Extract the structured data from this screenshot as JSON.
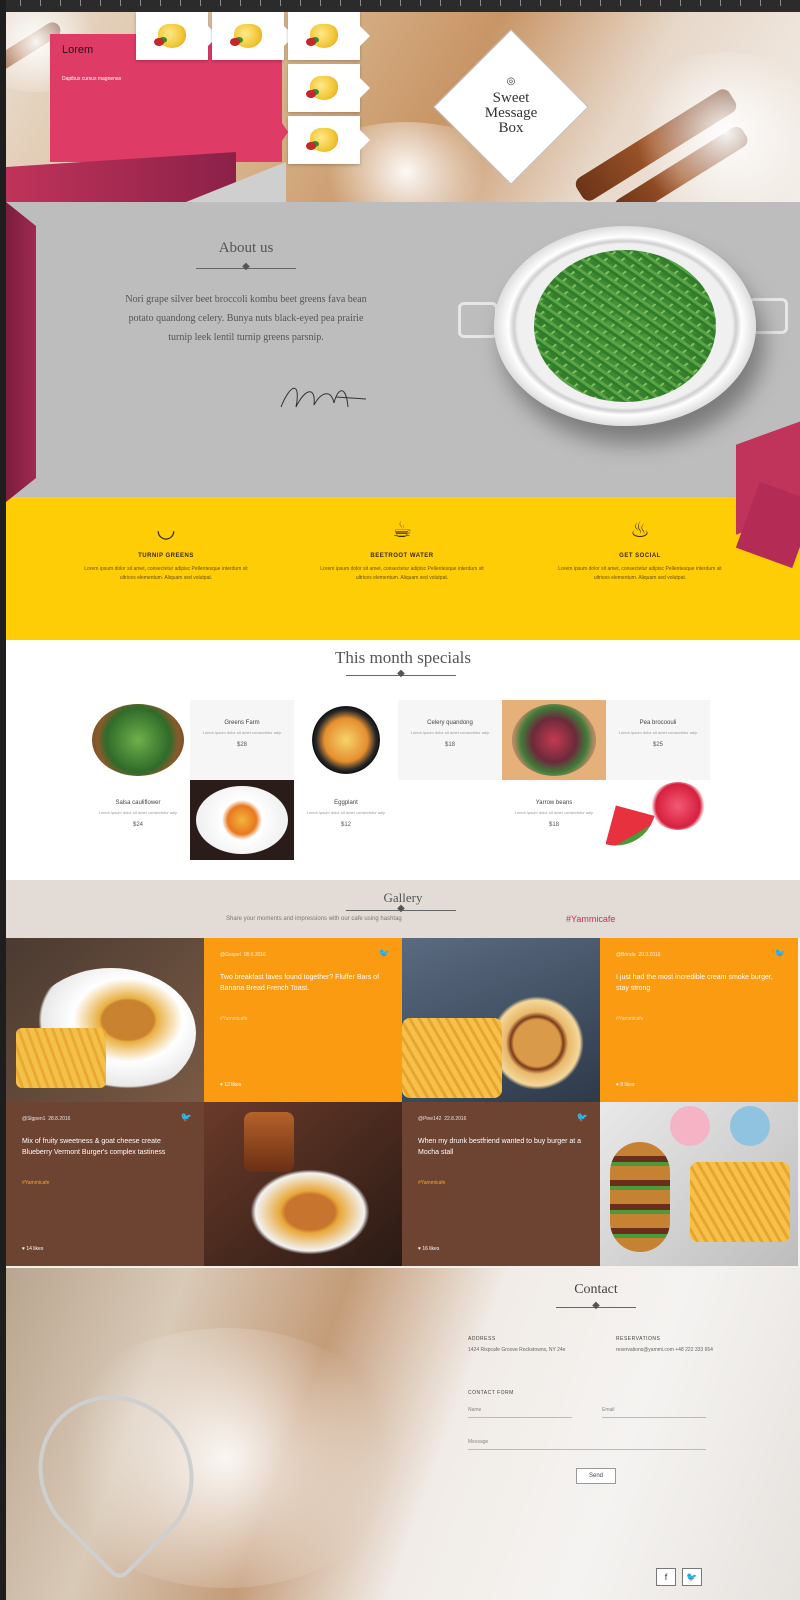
{
  "promo": {
    "title": "Lorem",
    "text": "Dapibus cursus magnenas"
  },
  "logo": {
    "line1": "Sweet",
    "line2": "Message",
    "line3": "Box"
  },
  "about": {
    "title": "About us",
    "text": "Nori grape silver beet broccoli kombu beet greens fava bean potato quandong celery. Bunya nuts black-eyed pea prairie turnip leek lentil turnip greens parsnip."
  },
  "features": [
    {
      "title": "Turnip greens",
      "text": "Lorem ipsum dolor sit amet, consectetur adipisc Pellentesque interdum sit ultrices elementum. Aliquam sed volutpat.",
      "icon": "noodle-bowl-icon"
    },
    {
      "title": "Beetroot water",
      "text": "Lorem ipsum dolor sit amet, consectetur adipisc Pellentesque interdum sit ultrices elementum. Aliquam sed volutpat.",
      "icon": "teapot-icon"
    },
    {
      "title": "Get social",
      "text": "Lorem ipsum dolor sit amet, consectetur adipisc Pellentesque interdum sit ultrices elementum. Aliquam sed volutpat.",
      "icon": "cupcake-icon"
    }
  ],
  "specials": {
    "title": "This month specials",
    "items": [
      {
        "name": "Greens Farm",
        "desc": "Lorem ipsum dolor sit amet consectetur adip",
        "price": "$28"
      },
      {
        "name": "Celery quandong",
        "desc": "Lorem ipsum dolor sit amet consectetur adip",
        "price": "$18"
      },
      {
        "name": "Pea brocoouli",
        "desc": "Lorem ipsum dolor sit amet consectetur adip",
        "price": "$25"
      },
      {
        "name": "Salsa cauliflower",
        "desc": "Lorem ipsum dolor sit amet consectetur adip",
        "price": "$24"
      },
      {
        "name": "Eggplant",
        "desc": "Lorem ipsum dolor sit amet consectetur adip",
        "price": "$12"
      },
      {
        "name": "Yarrow beans",
        "desc": "Lorem ipsum dolor sit amet consectetur adip",
        "price": "$18"
      }
    ]
  },
  "gallery": {
    "title": "Gallery",
    "subtitle": "Share your moments and impressions with our cafe using hashtag",
    "hashtag": "#Yammicafe",
    "posts": [
      {
        "user": "@Gospel",
        "date": "08.6.2016",
        "text": "Two breakfast faves found together? Fluffer Bars of Banana Bread French Toast.",
        "tag": "#Yammicafe",
        "likes": "12 likes"
      },
      {
        "user": "@Brinda",
        "date": "20.3.2016",
        "text": "I just had the most incredible cream smoke burger, stay strong",
        "tag": "#Yammicafe",
        "likes": "8 likes"
      },
      {
        "user": "@Slgpen1",
        "date": "28.8.2016",
        "text": "Mix of fruity sweetness & goat cheese create Blueberry Vermont Burger's complex tastiness",
        "tag": "#Yammicafe",
        "likes": "14 likes"
      },
      {
        "user": "@Pine142",
        "date": "22.8.2016",
        "text": "When my drunk bestfriend wanted to buy burger at a Mocha stall",
        "tag": "#Yammicafe",
        "likes": "16 likes"
      }
    ]
  },
  "contact": {
    "title": "Contact",
    "address_label": "Address",
    "address": "1424 Rispcafe Groove Rockstowns, NY 24e",
    "reservation_label": "Reservations",
    "reservation": "reservations@yammi.com +48 222 333 654",
    "form_label": "Contact form",
    "name_ph": "Name",
    "email_ph": "Email",
    "message_ph": "Message",
    "send": "Send"
  },
  "colors": {
    "pink": "#de3b66",
    "yellow": "#ffcd05",
    "orange": "#fb9b12",
    "brown": "#6d4332",
    "grey": "#bdbdbd"
  }
}
